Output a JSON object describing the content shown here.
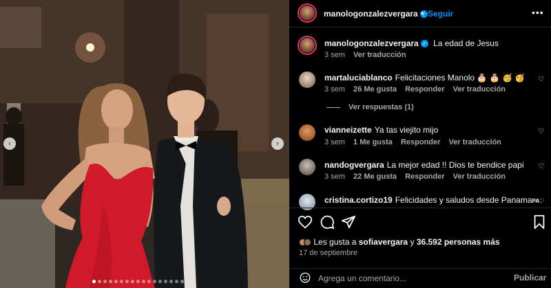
{
  "post": {
    "author": "manologonzalezvergara",
    "follow_label": "Seguir",
    "caption_text": "La edad de Jesus",
    "caption_time": "3 sem",
    "caption_translate": "Ver traducción"
  },
  "comments": [
    {
      "user": "martaluciablanco",
      "text": "Felicitaciones Manolo 🎂 🎂 🥳 🥳",
      "time": "3 sem",
      "likes": "26 Me gusta",
      "reply": "Responder",
      "translate": "Ver traducción"
    },
    {
      "user": "vianneizette",
      "text": "Ya tas viejito mijo",
      "time": "3 sem",
      "likes": "1 Me gusta",
      "reply": "Responder",
      "translate": "Ver traducción"
    },
    {
      "user": "nandogvergara",
      "text": "La mejor edad !! Dios te bendice papi",
      "time": "3 sem",
      "likes": "22 Me gusta",
      "reply": "Responder",
      "translate": "Ver traducción"
    },
    {
      "user": "cristina.cortizo19",
      "text": "Felicidades y saludos desde Panama",
      "suffix": "PA"
    }
  ],
  "replies_label": "Ver respuestas (1)",
  "likes": {
    "prefix": "Les gusta a",
    "user": "sofiavergara",
    "connector": "y",
    "others": "36.592 personas más"
  },
  "date": "17 de septiembre",
  "composer": {
    "placeholder": "Agrega un comentario...",
    "publish_label": "Publicar"
  },
  "carousel": {
    "total_slides": 17,
    "active_index": 0
  },
  "icons": {
    "like": "heart-icon",
    "comment": "comment-icon",
    "share": "share-icon",
    "save": "bookmark-icon",
    "emoji": "emoji-icon",
    "more": "more-horizontal-icon",
    "prev": "chevron-left-icon",
    "next": "chevron-right-icon"
  },
  "colors": {
    "accent": "#0095f6",
    "muted": "#a8a8a8",
    "background": "#000000",
    "dress": "#d01a2a"
  }
}
